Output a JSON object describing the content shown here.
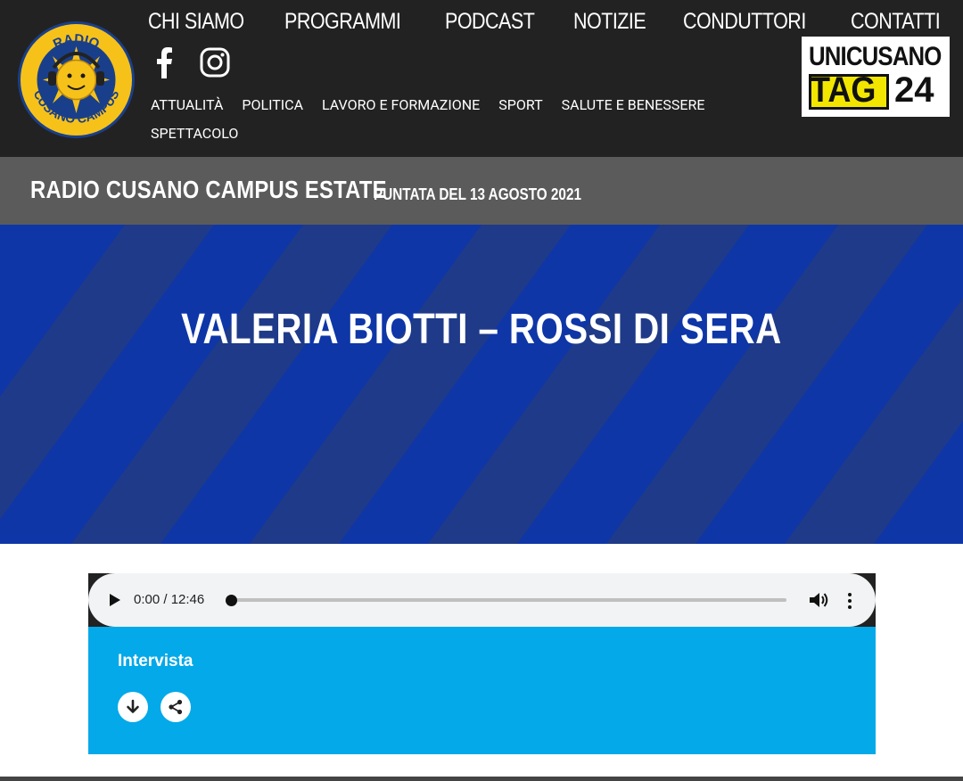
{
  "header": {
    "logo": {
      "top_text": "RADIO",
      "bottom_text": "CUSANO CAMPUS"
    },
    "main_nav": [
      "CHI SIAMO",
      "PROGRAMMI",
      "PODCAST",
      "NOTIZIE",
      "CONDUTTORI",
      "CONTATTI"
    ],
    "social": [
      "facebook-icon",
      "instagram-icon"
    ],
    "categories": [
      "ATTUALITÀ",
      "POLITICA",
      "LAVORO E FORMAZIONE",
      "SPORT",
      "SALUTE E BENESSERE",
      "SPETTACOLO"
    ],
    "partner": {
      "line1": "UNICUSANO",
      "line2a": "TAG",
      "line2b": "24"
    }
  },
  "title_bar": {
    "show": "RADIO CUSANO CAMPUS ESTATE",
    "episode": "PUNTATA DEL 13 AGOSTO 2021"
  },
  "hero": {
    "title": "VALERIA BIOTTI – ROSSI DI SERA"
  },
  "player": {
    "time": "0:00 / 12:46",
    "progress": 0,
    "label": "Intervista",
    "icons": [
      "play-icon",
      "volume-icon",
      "more-vert-icon",
      "download-icon",
      "share-icon"
    ]
  },
  "colors": {
    "header_bg": "#222222",
    "title_bar_bg": "#5b5b5b",
    "hero_blue": "#0e36a7",
    "hero_stripe": "#1f3a88",
    "player_card": "#03a9e9",
    "logo_yellow": "#f6c21a"
  }
}
